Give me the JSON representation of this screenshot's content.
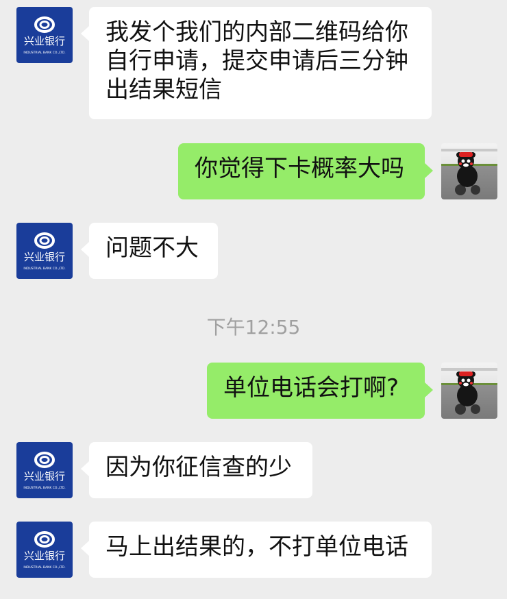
{
  "bank": {
    "logo_name": "兴业银行",
    "logo_subtext": "INDUSTRIAL BANK CO.,LTD."
  },
  "messages": [
    {
      "side": "left",
      "sender": "bank",
      "text": "我发个我们的内部二维码给你\n自行申请，提交申请后三分钟\n出结果短信"
    },
    {
      "side": "right",
      "sender": "me",
      "text": "你觉得下卡概率大吗"
    },
    {
      "side": "left",
      "sender": "bank",
      "text": "问题不大"
    },
    {
      "side": "right",
      "sender": "me",
      "text": "单位电话会打啊?"
    },
    {
      "side": "left",
      "sender": "bank",
      "text": "因为你征信查的少"
    },
    {
      "side": "left",
      "sender": "bank",
      "text": "马上出结果的，不打单位电话"
    }
  ],
  "timestamp": "下午12:55",
  "colors": {
    "background": "#ededed",
    "bubble_in": "#ffffff",
    "bubble_out": "#95ec69",
    "bank_avatar_bg": "#1a3d9a"
  },
  "icons": {
    "bank_avatar": "industrial-bank-logo-icon",
    "user_avatar": "kumamon-motorbike-avatar"
  }
}
